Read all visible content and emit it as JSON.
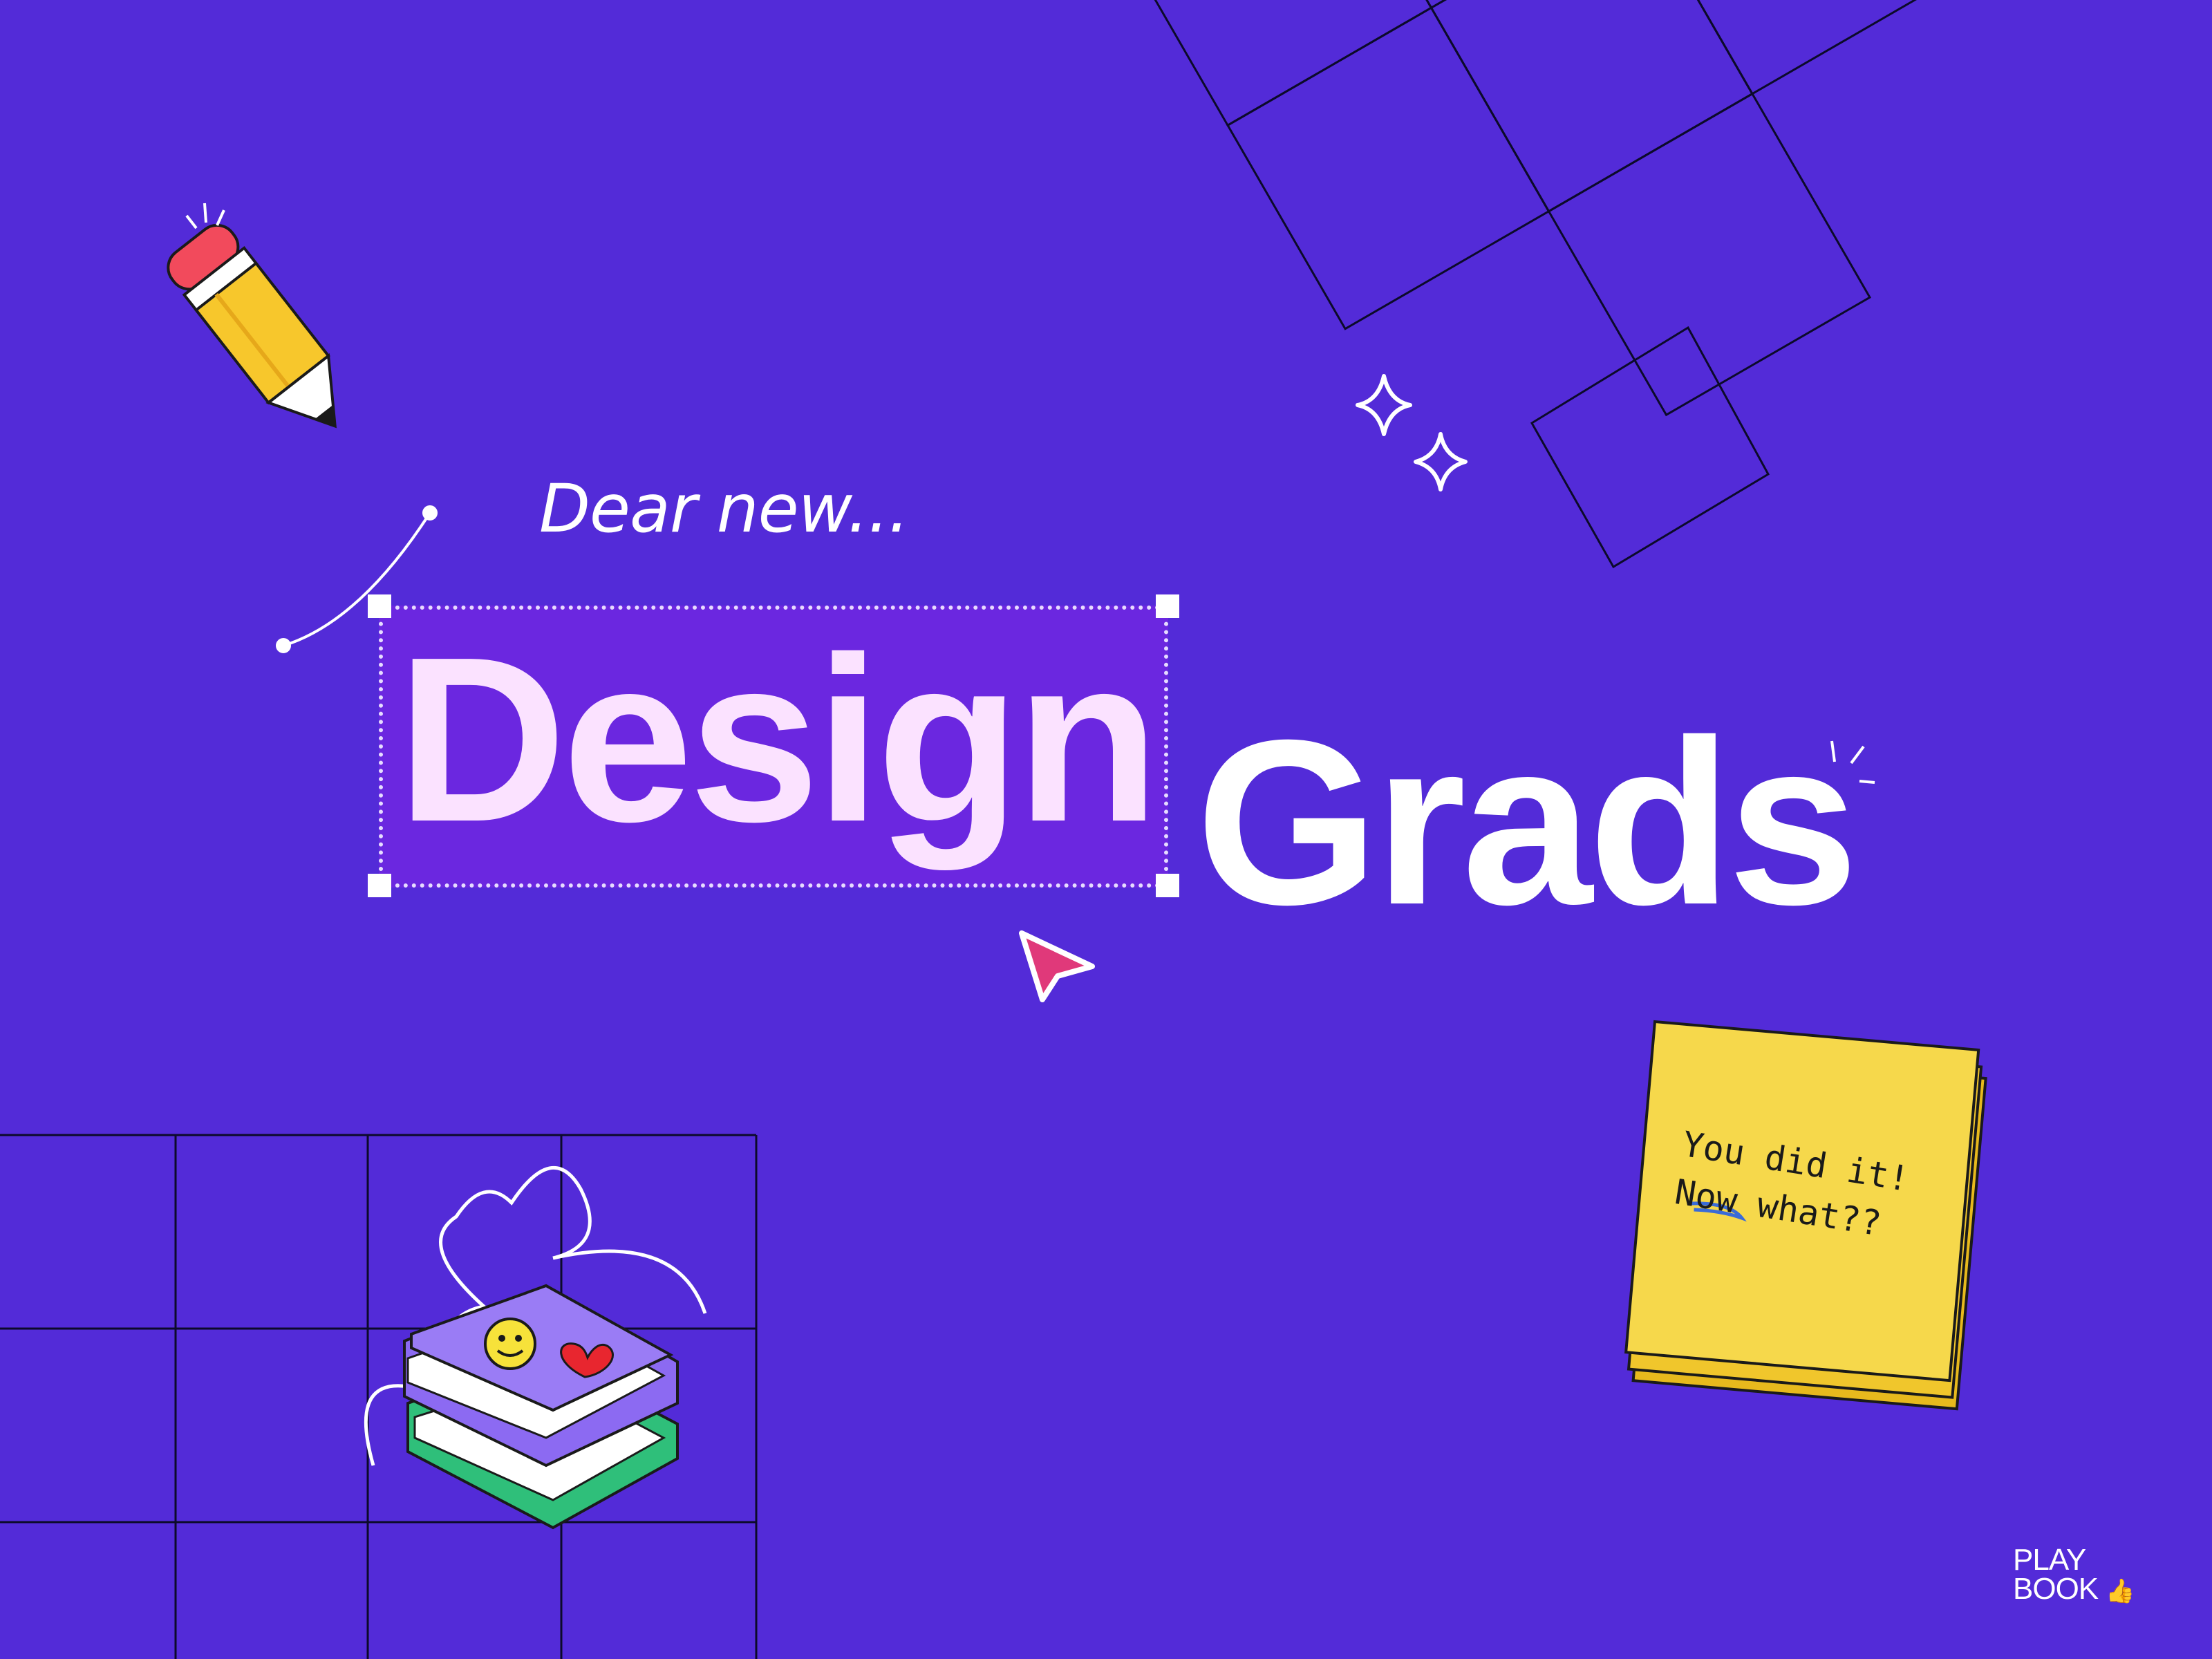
{
  "colors": {
    "background": "#532bd8",
    "selection_fill": "#6b27e0",
    "design_text": "#fbe2ff",
    "white": "#ffffff",
    "sticky_note": "#f6d84b",
    "cursor": "#e0397a"
  },
  "headline": {
    "intro": "Dear new...",
    "word_selected": "Design",
    "word_plain": "Grads"
  },
  "sticky_note": {
    "line1": "You did it!",
    "line2": "Now what??"
  },
  "logo": {
    "line1": "PLAY",
    "line2": "BOOK"
  },
  "icons": [
    "pencil-icon",
    "sparkle-icon",
    "cursor-arrow-icon",
    "books-icon",
    "smiley-icon",
    "heart-icon",
    "thumbs-up-icon"
  ]
}
